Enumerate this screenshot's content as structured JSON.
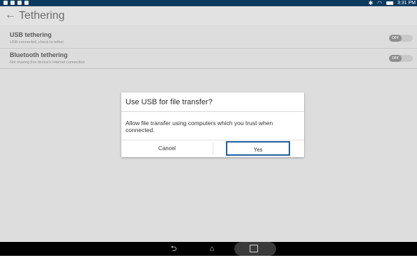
{
  "status_bar": {
    "time": "3:31 PM",
    "icons": [
      "notification-icon",
      "image-icon",
      "lock-icon",
      "sync-icon",
      "bluetooth-icon",
      "wifi-icon",
      "battery-icon"
    ]
  },
  "app_bar": {
    "back_icon": "←",
    "title": "Tethering"
  },
  "settings": {
    "items": [
      {
        "title": "USB tethering",
        "subtitle": "USB connected, check to tether",
        "toggle_label": "OFF"
      },
      {
        "title": "Bluetooth tethering",
        "subtitle": "Not sharing this device's Internet connection",
        "toggle_label": "OFF"
      }
    ]
  },
  "dialog": {
    "title": "Use USB for file transfer?",
    "message": "Allow file transfer using computers which you trust when connected.",
    "cancel_label": "Cancel",
    "yes_label": "Yes"
  },
  "nav_bar": {
    "back": "⮌",
    "home": "⌂"
  }
}
